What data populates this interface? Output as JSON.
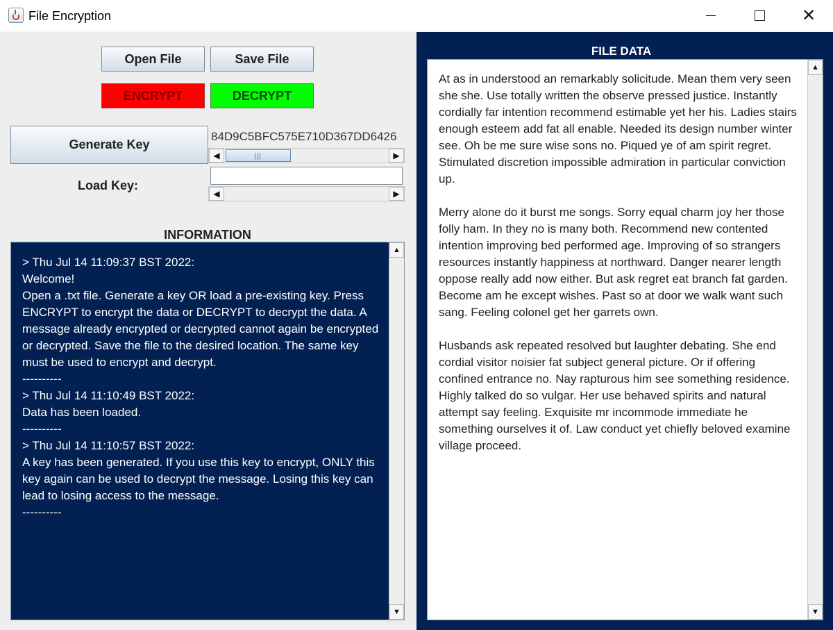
{
  "window": {
    "title": "File Encryption",
    "icon": "java-cup-icon",
    "controls": {
      "minimize": "minimize-icon",
      "maximize": "maximize-icon",
      "close": "✕"
    }
  },
  "toolbar": {
    "open_label": "Open File",
    "save_label": "Save File",
    "encrypt_label": "ENCRYPT",
    "decrypt_label": "DECRYPT",
    "encrypt_color": "#ff0000",
    "decrypt_color": "#00ff00"
  },
  "key": {
    "generate_label": "Generate Key",
    "generated_value": "84D9C5BFC575E710D367DD6426",
    "load_label": "Load Key:",
    "load_value": ""
  },
  "information": {
    "heading": "INFORMATION",
    "background": "#022152",
    "log": [
      "> Thu Jul 14 11:09:37 BST 2022:",
      "Welcome!",
      "Open a .txt file. Generate a key OR load a pre-existing key. Press ENCRYPT to encrypt the data or DECRYPT to decrypt the data. A message already encrypted or decrypted cannot again be encrypted or decrypted. Save the file to the desired location. The same key must be used to encrypt and decrypt.",
      "----------",
      "> Thu Jul 14 11:10:49 BST 2022:",
      "Data has been loaded.",
      "----------",
      "> Thu Jul 14 11:10:57 BST 2022:",
      "A key has been generated. If you use this key to encrypt, ONLY this key again can be used to decrypt the message. Losing this key can lead to losing access to the message.",
      "----------"
    ]
  },
  "file_data": {
    "heading": "FILE DATA",
    "paragraphs": [
      "At as in understood an remarkably solicitude. Mean them very seen she she. Use totally written the observe pressed justice. Instantly cordially far intention recommend estimable yet her his. Ladies stairs enough esteem add fat all enable. Needed its design number winter see. Oh be me sure wise sons no. Piqued ye of am spirit regret. Stimulated discretion impossible admiration in particular conviction up.",
      "Merry alone do it burst me songs. Sorry equal charm joy her those folly ham. In they no is many both. Recommend new contented intention improving bed performed age. Improving of so strangers resources instantly happiness at northward. Danger nearer length oppose really add now either. But ask regret eat branch fat garden. Become am he except wishes. Past so at door we walk want such sang. Feeling colonel get her garrets own.",
      "Husbands ask repeated resolved but laughter debating. She end cordial visitor noisier fat subject general picture. Or if offering confined entrance no. Nay rapturous him see something residence. Highly talked do so vulgar. Her use behaved spirits and natural attempt say feeling. Exquisite mr incommode immediate he something ourselves it of. Law conduct yet chiefly beloved examine village proceed."
    ]
  }
}
